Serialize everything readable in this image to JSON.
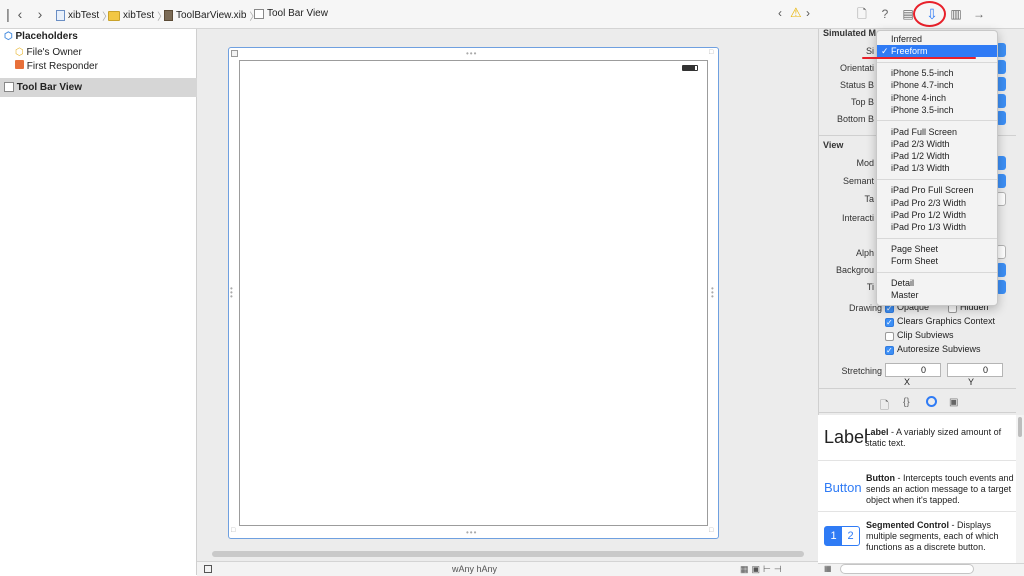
{
  "jumpbar": {
    "crumbs": [
      "xibTest",
      "xibTest",
      "ToolBarView.xib",
      "Tool Bar View"
    ]
  },
  "outline": {
    "placeholders_label": "Placeholders",
    "files_owner": "File's Owner",
    "first_responder": "First Responder",
    "tool_bar_view": "Tool Bar View"
  },
  "canvas": {
    "size_class": "wAny hAny"
  },
  "inspector": {
    "simulated_title": "Simulated M",
    "sim_labels": [
      "Si",
      "Orientati",
      "Status B",
      "Top B",
      "Bottom B"
    ],
    "view_title": "View",
    "view_labels": [
      "Mod",
      "Semant",
      "Ta",
      "Interacti",
      "Alph",
      "Backgrou",
      "Ti"
    ],
    "drawing_label": "Drawing",
    "drawing_checks": [
      {
        "label": "Opaque",
        "checked": true
      },
      {
        "label": "Hidden",
        "checked": false
      },
      {
        "label": "Clears Graphics Context",
        "checked": true
      },
      {
        "label": "Clip Subviews",
        "checked": false
      },
      {
        "label": "Autoresize Subviews",
        "checked": true
      }
    ],
    "stretching_label": "Stretching",
    "stretch_x": "0",
    "stretch_y": "0",
    "x_label": "X",
    "y_label": "Y"
  },
  "library": {
    "items": [
      {
        "icon": "Label",
        "name": "Label",
        "desc": " - A variably sized amount of static text."
      },
      {
        "icon": "Button",
        "name": "Button",
        "desc": " - Intercepts touch events and sends an action message to a target object when it's tapped."
      },
      {
        "icon": "12",
        "name": "Segmented Control",
        "desc": " - Displays multiple segments, each of which functions as a discrete button."
      }
    ]
  },
  "dropdown": {
    "groups": [
      [
        "Inferred",
        "Freeform"
      ],
      [
        "iPhone 5.5-inch",
        "iPhone 4.7-inch",
        "iPhone 4-inch",
        "iPhone 3.5-inch"
      ],
      [
        "iPad Full Screen",
        "iPad 2/3 Width",
        "iPad 1/2 Width",
        "iPad 1/3 Width"
      ],
      [
        "iPad Pro Full Screen",
        "iPad Pro 2/3 Width",
        "iPad Pro 1/2 Width",
        "iPad Pro 1/3 Width"
      ],
      [
        "Page Sheet",
        "Form Sheet"
      ],
      [
        "Detail",
        "Master"
      ]
    ],
    "selected": "Freeform"
  },
  "colors": {
    "accent": "#2f7bf5",
    "annotation": "#e8202a"
  }
}
